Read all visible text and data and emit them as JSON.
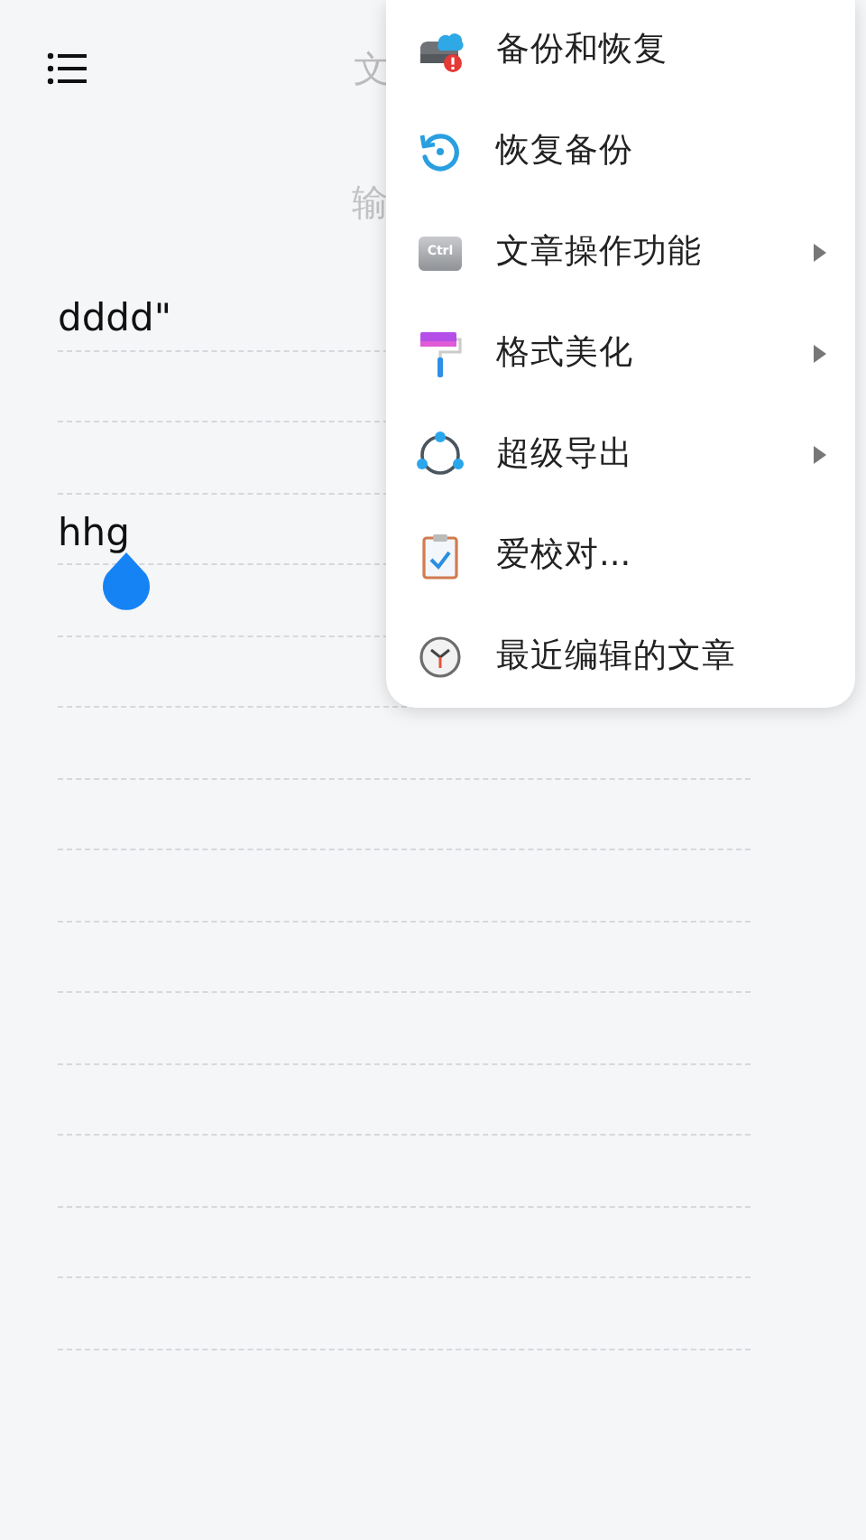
{
  "header": {
    "title": "文"
  },
  "title_field": {
    "placeholder": "输"
  },
  "editor": {
    "lines": [
      {
        "kind": "text",
        "text": "dddd\""
      },
      {
        "kind": "blank"
      },
      {
        "kind": "blank"
      },
      {
        "kind": "text",
        "text": "hhg"
      }
    ]
  },
  "menu": {
    "items": [
      {
        "label": "备份和恢复",
        "submenu": false
      },
      {
        "label": "恢复备份",
        "submenu": false
      },
      {
        "label": "文章操作功能",
        "submenu": true,
        "key_label": "Ctrl"
      },
      {
        "label": "格式美化",
        "submenu": true
      },
      {
        "label": "超级导出",
        "submenu": true
      },
      {
        "label": "爱校对...",
        "submenu": false
      },
      {
        "label": "最近编辑的文章",
        "submenu": false
      }
    ]
  }
}
